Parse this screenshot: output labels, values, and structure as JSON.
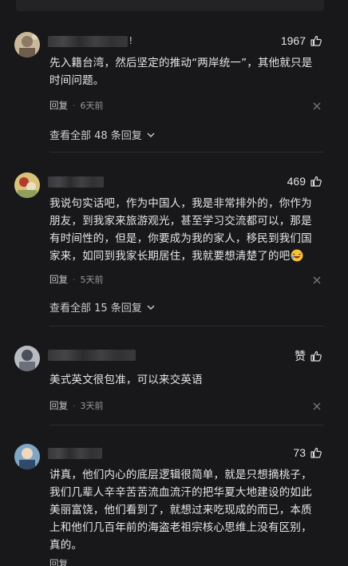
{
  "comments": [
    {
      "name_suffix": "!",
      "likes": "1967",
      "text_lines": [
        "先入籍台湾，然后坚定的推动“两岸统一”，其他就只是",
        "时间问题。"
      ],
      "reply": "回复",
      "dot": "·",
      "time": "6天前",
      "view_all": "查看全部 48 条回复"
    },
    {
      "likes": "469",
      "text_lines": [
        "我说句实话吧，作为中国人，我是非常排外的，你作为",
        "朋友，到我家来旅游观光，甚至学习交流都可以，那是",
        "有时间性的，但是，你要成为我的家人，移民到我们国",
        "家来，如同到我家长期居住，我就要想清楚了的吧"
      ],
      "reply": "回复",
      "dot": "·",
      "time": "5天前",
      "view_all": "查看全部 15 条回复"
    },
    {
      "likes": "赞",
      "text_lines": [
        "美式英文很包准，可以来交英语"
      ],
      "reply": "回复",
      "dot": "·",
      "time": "3天前"
    },
    {
      "likes": "73",
      "text_lines": [
        "讲真，他们内心的底层逻辑很简单，就是只想摘桃子，",
        "我们几辈人辛辛苦苦流血流汗的把华夏大地建设的如此",
        "美丽富饶，他们看到了，就想过来吃现成的而已，本质",
        "上和他们几百年前的海盗老祖宗核心思维上没有区别，",
        "真的。"
      ],
      "reply": "回复"
    }
  ],
  "icons": {
    "like": "thumbs-up-icon",
    "close": "close-icon",
    "chevron": "chevron-down-icon",
    "emoji": "laughing-emoji-icon"
  }
}
